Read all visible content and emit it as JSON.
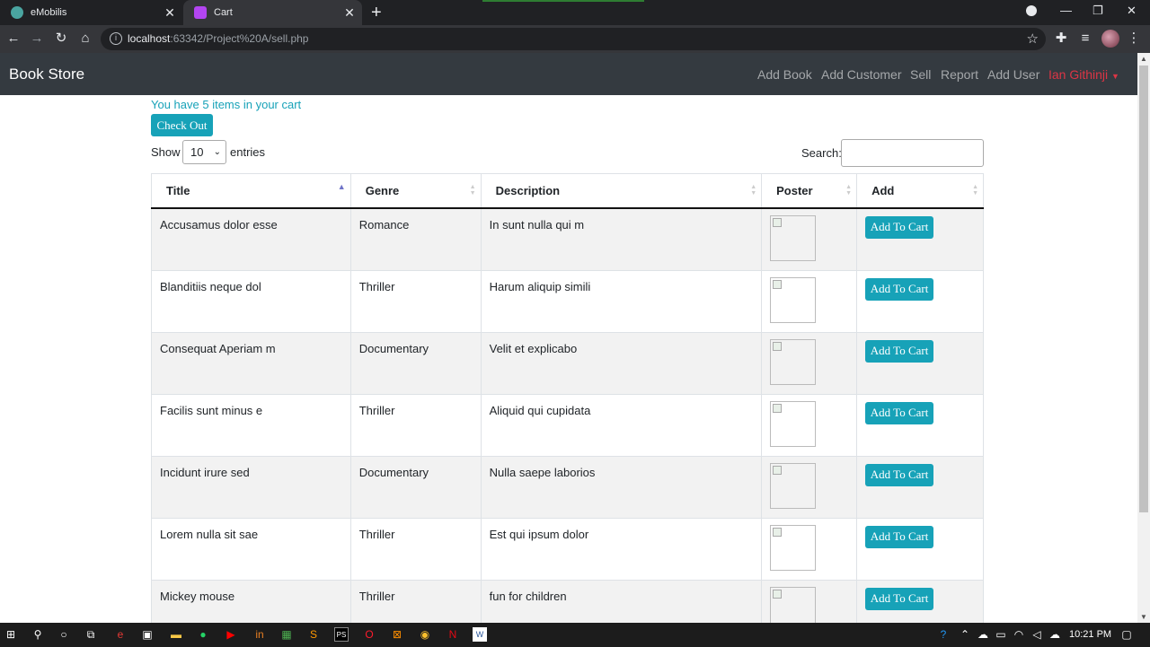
{
  "browser": {
    "tabs": [
      {
        "title": "eMobilis",
        "active": false
      },
      {
        "title": "Cart",
        "active": true
      }
    ],
    "url_host": "localhost",
    "url_path": ":63342/Project%20A/sell.php"
  },
  "navbar": {
    "brand": "Book Store",
    "links": [
      "Add Book",
      "Add Customer",
      "Sell",
      "Report",
      "Add User"
    ],
    "user": "Ian Githinji"
  },
  "cart": {
    "message": "You have 5 items in your cart",
    "checkout_label": "Check Out"
  },
  "table_controls": {
    "show_label": "Show",
    "entries_value": "10",
    "entries_label": "entries",
    "search_label": "Search:"
  },
  "table": {
    "columns": [
      "Title",
      "Genre",
      "Description",
      "Poster",
      "Add"
    ],
    "add_label": "Add To Cart",
    "rows": [
      {
        "title": "Accusamus dolor esse",
        "genre": "Romance",
        "description": "In sunt nulla qui m"
      },
      {
        "title": "Blanditiis neque dol",
        "genre": "Thriller",
        "description": "Harum aliquip simili"
      },
      {
        "title": "Consequat Aperiam m",
        "genre": "Documentary",
        "description": "Velit et explicabo"
      },
      {
        "title": "Facilis sunt minus e",
        "genre": "Thriller",
        "description": "Aliquid qui cupidata"
      },
      {
        "title": "Incidunt irure sed",
        "genre": "Documentary",
        "description": "Nulla saepe laborios"
      },
      {
        "title": "Lorem nulla sit sae",
        "genre": "Thriller",
        "description": "Est qui ipsum dolor"
      },
      {
        "title": "Mickey mouse",
        "genre": "Thriller",
        "description": "fun for children"
      }
    ]
  },
  "taskbar": {
    "clock": "10:21 PM"
  },
  "colors": {
    "accent": "#17a2b8",
    "navbar_bg": "#343a40",
    "user_link": "#dc3545"
  }
}
